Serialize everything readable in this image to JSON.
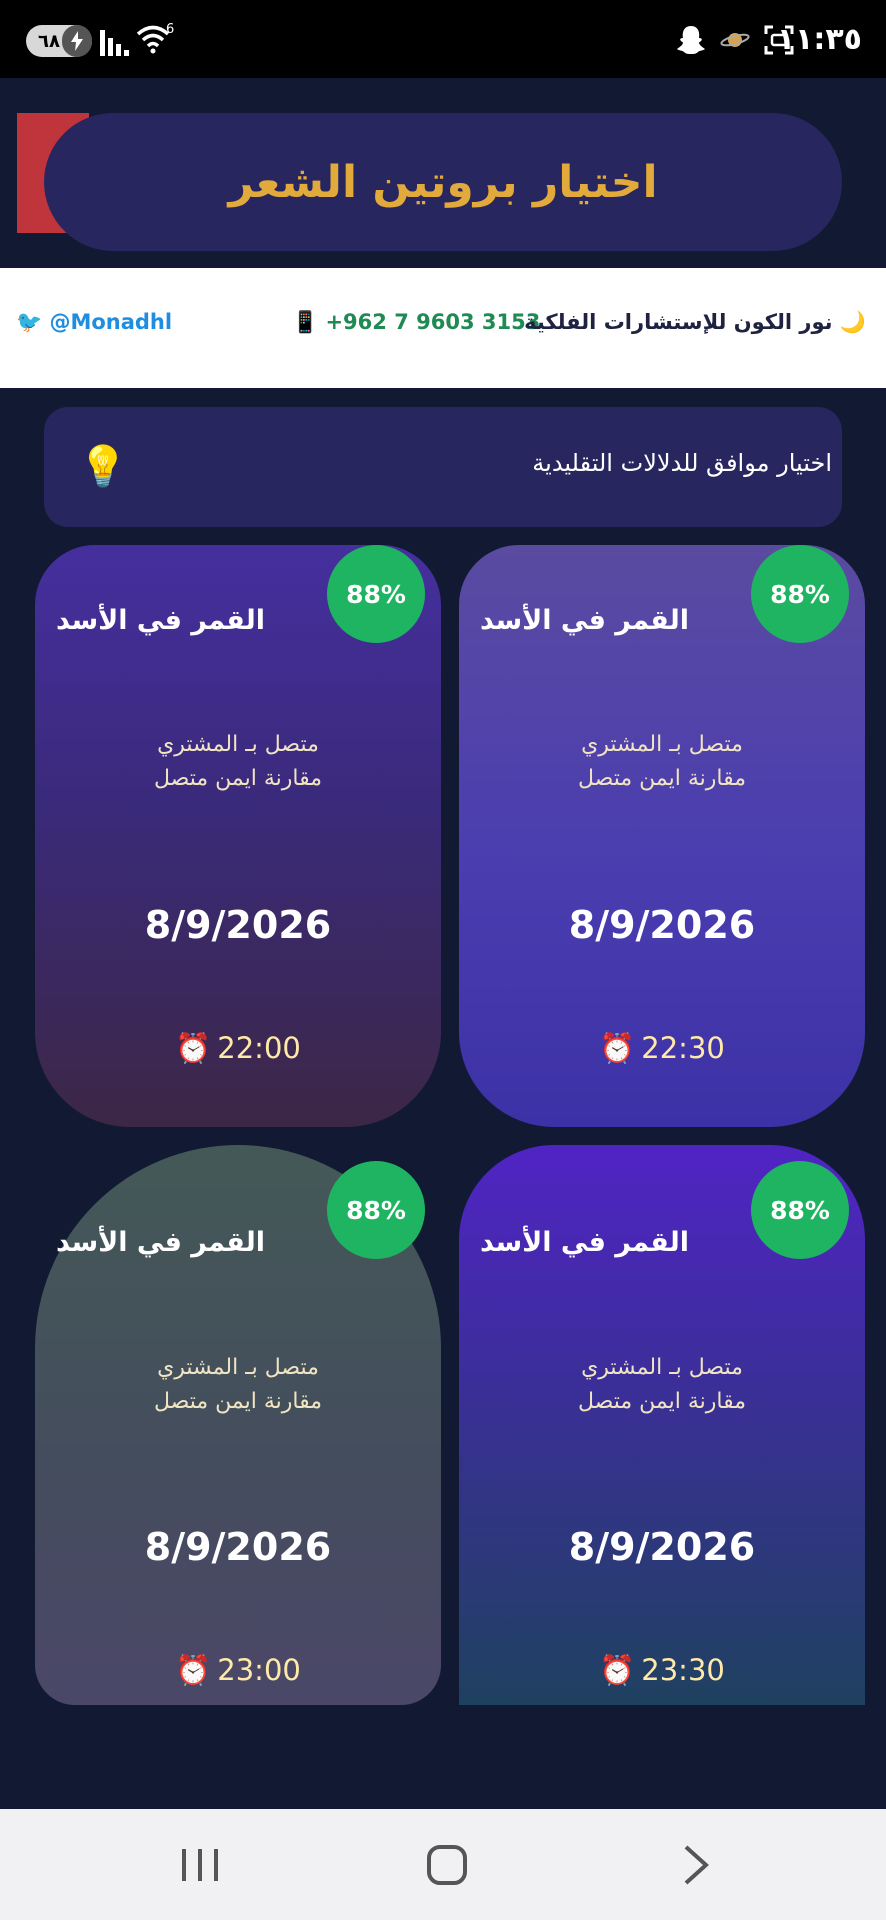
{
  "status_bar": {
    "battery": "٦٨",
    "wifi_label": "6",
    "time": "١١:٣٥"
  },
  "header": {
    "title": "اختيار بروتين الشعر",
    "accent_color": "#e2a93b"
  },
  "contact": {
    "twitter": "🐦 @Monadhl",
    "phone": "📱 +962 7 9603 3153",
    "brand": "🌙 نور الكون للإستشارات الفلكية"
  },
  "notice": {
    "text": "اختيار موافق للدلالات التقليدية",
    "icon": "💡"
  },
  "cards": [
    {
      "badge": "88%",
      "title": "القمر في الأسد",
      "line1": "متصل بـ المشتري",
      "line2": "مقارنة ايمن متصل",
      "date": "8/9/2026",
      "time": "22:30"
    },
    {
      "badge": "88%",
      "title": "القمر في الأسد",
      "line1": "متصل بـ المشتري",
      "line2": "مقارنة ايمن متصل",
      "date": "8/9/2026",
      "time": "22:00"
    },
    {
      "badge": "88%",
      "title": "القمر في الأسد",
      "line1": "متصل بـ المشتري",
      "line2": "مقارنة ايمن متصل",
      "date": "8/9/2026",
      "time": "23:30"
    },
    {
      "badge": "88%",
      "title": "القمر في الأسد",
      "line1": "متصل بـ المشتري",
      "line2": "مقارنة ايمن متصل",
      "date": "8/9/2026",
      "time": "23:00"
    }
  ],
  "colors": {
    "background": "#121a33",
    "badge": "#1fb462",
    "pill": "#28265f"
  }
}
